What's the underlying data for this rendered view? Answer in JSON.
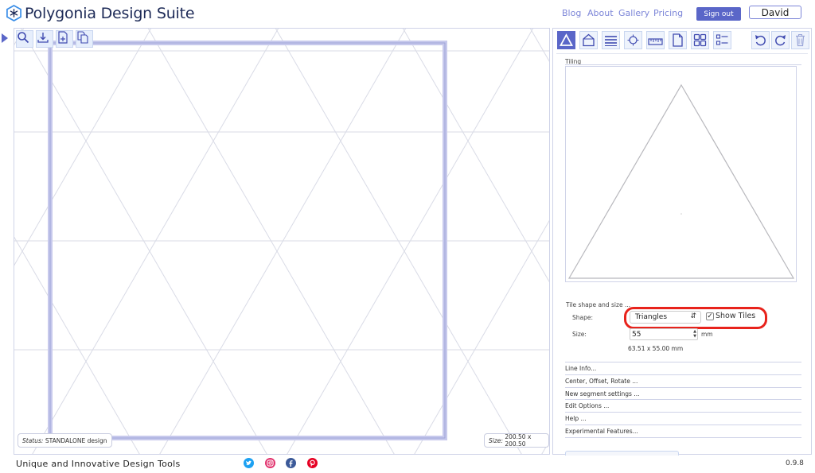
{
  "app": {
    "title": "Polygonia Design Suite",
    "brand_color": "#5a66c8"
  },
  "header": {
    "nav": [
      {
        "label": "Blog"
      },
      {
        "label": "About"
      },
      {
        "label": "Gallery"
      },
      {
        "label": "Pricing"
      }
    ],
    "signout_label": "Sign out",
    "user_name": "David"
  },
  "canvas": {
    "tools": [
      {
        "icon": "zoom-icon"
      },
      {
        "icon": "download-icon"
      },
      {
        "icon": "new-document-icon"
      },
      {
        "icon": "duplicate-icon"
      }
    ],
    "status_label": "Status:",
    "status_value": "STANDALONE design",
    "size_label": "Size:",
    "size_value": "200.50 x 200.50"
  },
  "panel": {
    "tools": [
      {
        "icon": "triangle-icon",
        "active": true
      },
      {
        "icon": "house-shape-icon"
      },
      {
        "icon": "lines-icon"
      },
      {
        "icon": "target-icon"
      },
      {
        "icon": "ruler-icon"
      },
      {
        "icon": "page-icon"
      },
      {
        "icon": "grid-icon"
      },
      {
        "icon": "list-icon"
      },
      {
        "icon": "undo-icon"
      },
      {
        "icon": "redo-icon"
      },
      {
        "icon": "trash-icon"
      }
    ],
    "tiling_label": "Tiling",
    "tile_section_title": "Tile shape and size ...",
    "shape_label": "Shape:",
    "shape_value": "Triangles",
    "show_tiles_label": "Show Tiles",
    "show_tiles_checked": true,
    "size_label": "Size:",
    "size_value": "55",
    "size_unit": "mm",
    "dimensions": "63.51 x 55.00  mm",
    "accordion": [
      {
        "label": "Line Info..."
      },
      {
        "label": "Center, Offset, Rotate ..."
      },
      {
        "label": "New segment settings ..."
      },
      {
        "label": "Edit Options ..."
      },
      {
        "label": "Help ..."
      },
      {
        "label": "Experimental Features..."
      }
    ]
  },
  "footer": {
    "tagline": "Unique and Innovative Design Tools",
    "social": [
      {
        "icon": "twitter-icon",
        "color": "#1da1f2"
      },
      {
        "icon": "instagram-icon",
        "color": "#e1306c"
      },
      {
        "icon": "facebook-icon",
        "color": "#3b5998"
      },
      {
        "icon": "pinterest-icon",
        "color": "#e60023"
      }
    ],
    "version": "0.9.8"
  }
}
